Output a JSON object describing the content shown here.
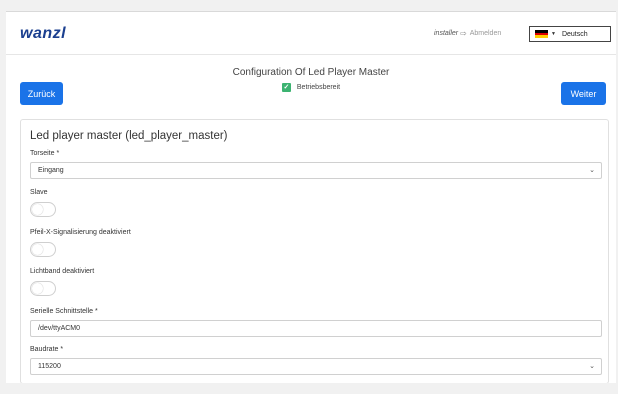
{
  "header": {
    "logo": "wanzl",
    "user": "installer",
    "logout_label": "Abmelden",
    "language": "Deutsch",
    "flag_colors": [
      "#000000",
      "#dd0000",
      "#ffce00"
    ]
  },
  "page": {
    "title": "Configuration Of Led Player Master",
    "status": "Betriebsbereit",
    "back_label": "Zurück",
    "next_label": "Weiter"
  },
  "form": {
    "title": "Led player master (led_player_master)",
    "torseite_label": "Torseite *",
    "torseite_value": "Eingang",
    "slave_label": "Slave",
    "slave_on": false,
    "pfeil_label": "Pfeil-X-Signalisierung deaktiviert",
    "pfeil_on": false,
    "lichtband_label": "Lichtband deaktiviert",
    "lichtband_on": false,
    "serial_label": "Serielle Schnittstelle *",
    "serial_value": "/dev/ttyACM0",
    "baud_label": "Baudrate *",
    "baud_value": "115200"
  },
  "colors": {
    "accent": "#1a73e8",
    "logo": "#1b3f8f",
    "status_green": "#3cb371"
  }
}
